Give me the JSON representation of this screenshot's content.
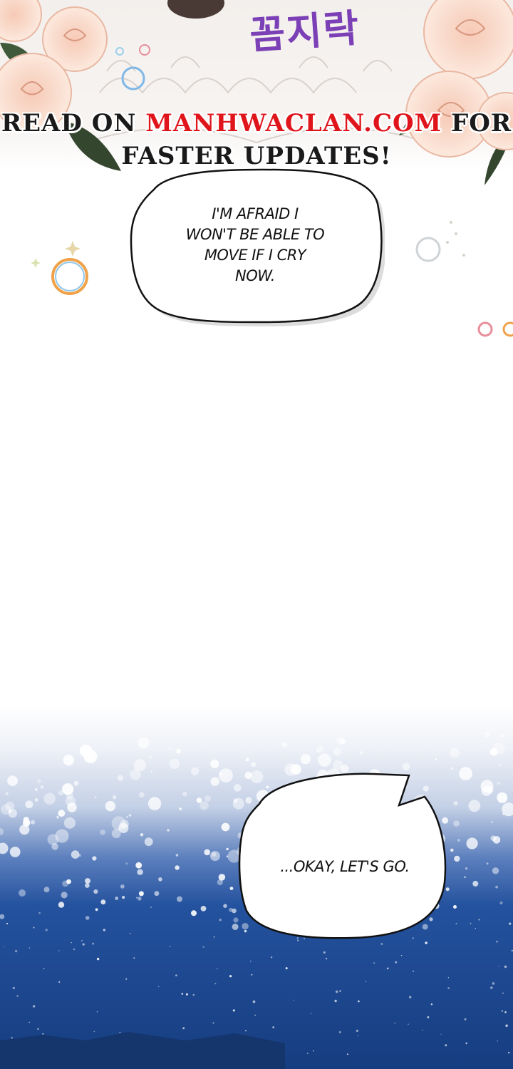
{
  "sfx": {
    "text": "꼼지락"
  },
  "promo": {
    "prefix": "READ ON ",
    "site": "MANHWACLAN.COM",
    "suffix": " FOR",
    "line2": "FASTER UPDATES!"
  },
  "bubbles": [
    {
      "lines": [
        "I'M AFRAID I",
        "WON'T BE ABLE TO",
        "MOVE IF I CRY",
        "NOW."
      ]
    },
    {
      "lines": [
        "...OKAY, LET'S GO."
      ]
    }
  ],
  "colors": {
    "accent_red": "#e0151b",
    "sfx_purple": "#7b3fb6",
    "night_blue": "#173f84"
  }
}
